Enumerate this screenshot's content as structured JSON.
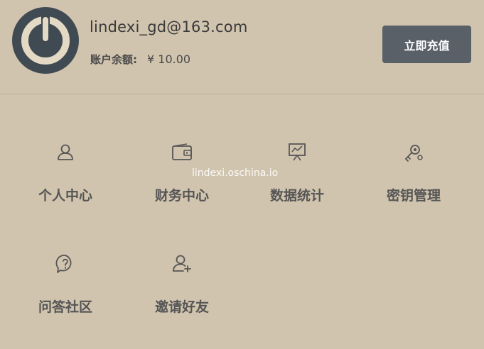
{
  "account": {
    "email": "lindexi_gd@163.com",
    "balance_label": "账户余额:",
    "balance_value": "¥ 10.00",
    "recharge_label": "立即充值",
    "avatar_icon": "power-icon"
  },
  "menu": [
    {
      "label": "个人中心",
      "icon": "user-icon"
    },
    {
      "label": "财务中心",
      "icon": "wallet-icon"
    },
    {
      "label": "数据统计",
      "icon": "chart-board-icon"
    },
    {
      "label": "密钥管理",
      "icon": "key-gear-icon"
    },
    {
      "label": "问答社区",
      "icon": "question-bubble-icon"
    },
    {
      "label": "邀请好友",
      "icon": "user-add-icon"
    }
  ],
  "watermark": "lindexi.oschina.io",
  "colors": {
    "background": "#d1c4ae",
    "button": "#5a6068",
    "avatar": "#3f4a52"
  }
}
